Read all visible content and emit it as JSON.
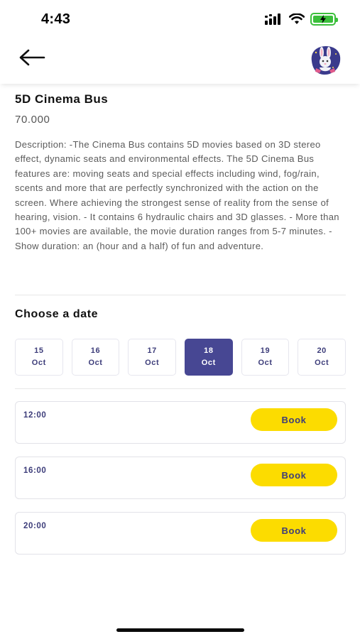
{
  "status_bar": {
    "time": "4:43"
  },
  "colors": {
    "accent": "#474793",
    "book_button": "#fcdc00",
    "battery": "#3bbf3b"
  },
  "header": {
    "back_icon": "arrow-left-icon",
    "logo_icon": "rabbit-mascot-logo"
  },
  "product": {
    "title": "5D Cinema Bus",
    "price": "70.000",
    "description": "Description: -The Cinema Bus contains 5D movies based on 3D stereo effect, dynamic seats and environmental effects. The 5D Cinema Bus features are: moving seats and special effects including wind, fog/rain, scents and more that are perfectly synchronized with the action on the screen. Where achieving the strongest sense of reality from the sense of hearing, vision. - It contains 6 hydraulic chairs and 3D glasses. - More than 100+ movies are available, the movie duration ranges from 5-7 minutes. - Show duration: an (hour and a half) of fun and adventure."
  },
  "dates": {
    "title": "Choose a date",
    "items": [
      {
        "day": "15",
        "month": "Oct"
      },
      {
        "day": "16",
        "month": "Oct"
      },
      {
        "day": "17",
        "month": "Oct"
      },
      {
        "day": "18",
        "month": "Oct",
        "selected": true
      },
      {
        "day": "19",
        "month": "Oct"
      },
      {
        "day": "20",
        "month": "Oct"
      }
    ]
  },
  "slots": [
    {
      "time": "12:00",
      "button": "Book"
    },
    {
      "time": "16:00",
      "button": "Book"
    },
    {
      "time": "20:00",
      "button": "Book"
    }
  ]
}
